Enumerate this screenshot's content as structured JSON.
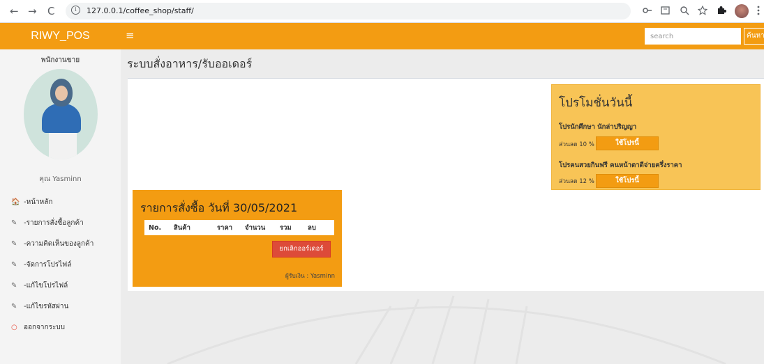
{
  "browser": {
    "url": "127.0.0.1/coffee_shop/staff/",
    "back_icon": "←",
    "forward_icon": "→",
    "reload_icon": "C",
    "info_icon": "i"
  },
  "header": {
    "brand": "RIWY_POS",
    "menu_icon": "≡",
    "search_placeholder": "search",
    "search_button": "ค้นหา"
  },
  "sidebar": {
    "role": "พนักงานขาย",
    "username": "คุณ Yasminn",
    "items": [
      {
        "icon": "home-icon",
        "glyph": "🏠",
        "label": "-หน้าหลัก"
      },
      {
        "icon": "edit-icon",
        "glyph": "✎",
        "label": "-รายการสั่งซื้อลูกค้า"
      },
      {
        "icon": "edit-icon",
        "glyph": "✎",
        "label": "-ความคิดเห็นของลูกค้า"
      },
      {
        "icon": "edit-icon",
        "glyph": "✎",
        "label": "-จัดการโปรไฟล์"
      },
      {
        "icon": "edit-icon",
        "glyph": "✎",
        "label": "-แก้ไขโปรไฟล์"
      },
      {
        "icon": "edit-icon",
        "glyph": "✎",
        "label": "-แก้ไขรหัสผ่าน"
      },
      {
        "icon": "logout-icon",
        "glyph": "○",
        "label": "ออกจากระบบ"
      }
    ]
  },
  "main": {
    "title": "ระบบสั่งอาหาร/รับออเดอร์",
    "promo": {
      "heading": "โปรโมชั่นวันนี้",
      "items": [
        {
          "title": "โปรนักศึกษา นักล่าปริญญา",
          "discount": "ส่วนลด 10 %",
          "button": "ใช้โปรนี้"
        },
        {
          "title": "โปรคนสวยกินฟรี คนหน้าตาดีจ่ายครึ่งราคา",
          "discount": "ส่วนลด 12 %",
          "button": "ใช้โปรนี้"
        }
      ]
    },
    "order": {
      "heading": "รายการสั่งซื้อ วันที่ 30/05/2021",
      "columns": [
        "No.",
        "สินค้า",
        "ราคา",
        "จำนวน",
        "รวม",
        "ลบ"
      ],
      "cancel_button": "ยกเลิกออร์เดอร์",
      "cashier": "ผู้รับเงิน : Yasminn"
    }
  },
  "colors": {
    "accent": "#f39c12",
    "promo_bg": "#f8c456",
    "danger": "#dd4b39",
    "sidebar_bg": "#f4f4f4"
  }
}
